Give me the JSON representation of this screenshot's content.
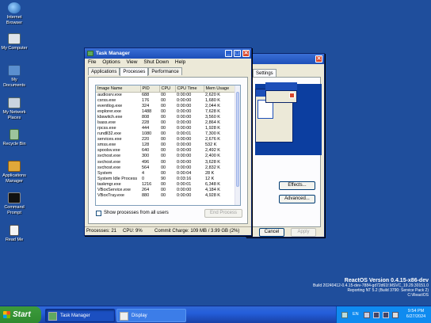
{
  "desktop": {
    "icons": [
      {
        "label": "Internet Browser"
      },
      {
        "label": "My Computer"
      },
      {
        "label": "My Documents"
      },
      {
        "label": "My Network Places"
      },
      {
        "label": "Recycle Bin"
      },
      {
        "label": "Applications Manager"
      },
      {
        "label": "Command Prompt"
      },
      {
        "label": "Read Me"
      }
    ],
    "watermark": {
      "line1": "ReactOS Version 0.4.15-x86-dev",
      "line2": "Build 20240412-0.4.15-dev-7884-gd72d61f.MSVC_19.29.30151.0",
      "line3": "Reporting NT 5.2 (Build 3790: Service Pack 2)",
      "line4": "C:\\ReactOS"
    }
  },
  "display_props": {
    "tab_settings": "Settings",
    "effects_label": "Effects...",
    "advanced_label": "Advanced...",
    "cancel_label": "Cancel",
    "apply_label": "Apply"
  },
  "taskmgr": {
    "title": "Task Manager",
    "menu": [
      "File",
      "Options",
      "View",
      "Shut Down",
      "Help"
    ],
    "tabs": [
      "Applications",
      "Processes",
      "Performance"
    ],
    "columns": [
      "Image Name",
      "PID",
      "CPU",
      "CPU Time",
      "Mem Usage"
    ],
    "rows": [
      [
        "audiosrv.exe",
        "688",
        "00",
        "0:00:00",
        "2,620 K"
      ],
      [
        "csrss.exe",
        "176",
        "00",
        "0:00:00",
        "1,680 K"
      ],
      [
        "eventlog.exe",
        "324",
        "00",
        "0:00:00",
        "2,044 K"
      ],
      [
        "explorer.exe",
        "1488",
        "00",
        "0:00:00",
        "7,628 K"
      ],
      [
        "kbswitch.exe",
        "808",
        "00",
        "0:00:00",
        "3,560 K"
      ],
      [
        "lsass.exe",
        "228",
        "00",
        "0:00:00",
        "2,864 K"
      ],
      [
        "rpcss.exe",
        "444",
        "00",
        "0:00:00",
        "1,928 K"
      ],
      [
        "rundll32.exe",
        "1080",
        "00",
        "0:00:01",
        "7,300 K"
      ],
      [
        "services.exe",
        "220",
        "00",
        "0:00:00",
        "2,676 K"
      ],
      [
        "smss.exe",
        "128",
        "00",
        "0:00:00",
        "532 K"
      ],
      [
        "spoolsv.exe",
        "640",
        "00",
        "0:00:00",
        "2,492 K"
      ],
      [
        "svchost.exe",
        "300",
        "00",
        "0:00:00",
        "2,400 K"
      ],
      [
        "svchost.exe",
        "496",
        "00",
        "0:00:00",
        "3,628 K"
      ],
      [
        "svchost.exe",
        "564",
        "00",
        "0:00:00",
        "2,832 K"
      ],
      [
        "System",
        "4",
        "00",
        "0:00:04",
        "28 K"
      ],
      [
        "System Idle Process",
        "0",
        "90",
        "0:03:16",
        "12 K"
      ],
      [
        "taskmgr.exe",
        "1216",
        "00",
        "0:00:01",
        "6,348 K"
      ],
      [
        "VBoxService.exe",
        "264",
        "00",
        "0:00:00",
        "4,184 K"
      ],
      [
        "VBoxTray.exe",
        "880",
        "00",
        "0:00:00",
        "4,928 K"
      ]
    ],
    "show_all_label": "Show processes from all users",
    "end_process_label": "End Process",
    "status": {
      "processes": "Processes: 21",
      "cpu": "CPU:  9%",
      "commit": "Commit Charge: 109 MB / 3.99 GB (2%)"
    }
  },
  "taskbar": {
    "start_label": "Start",
    "buttons": [
      "Task Manager",
      "Display"
    ],
    "lang": "EN",
    "time": "9:54 PM",
    "date": "6/27/2024"
  }
}
